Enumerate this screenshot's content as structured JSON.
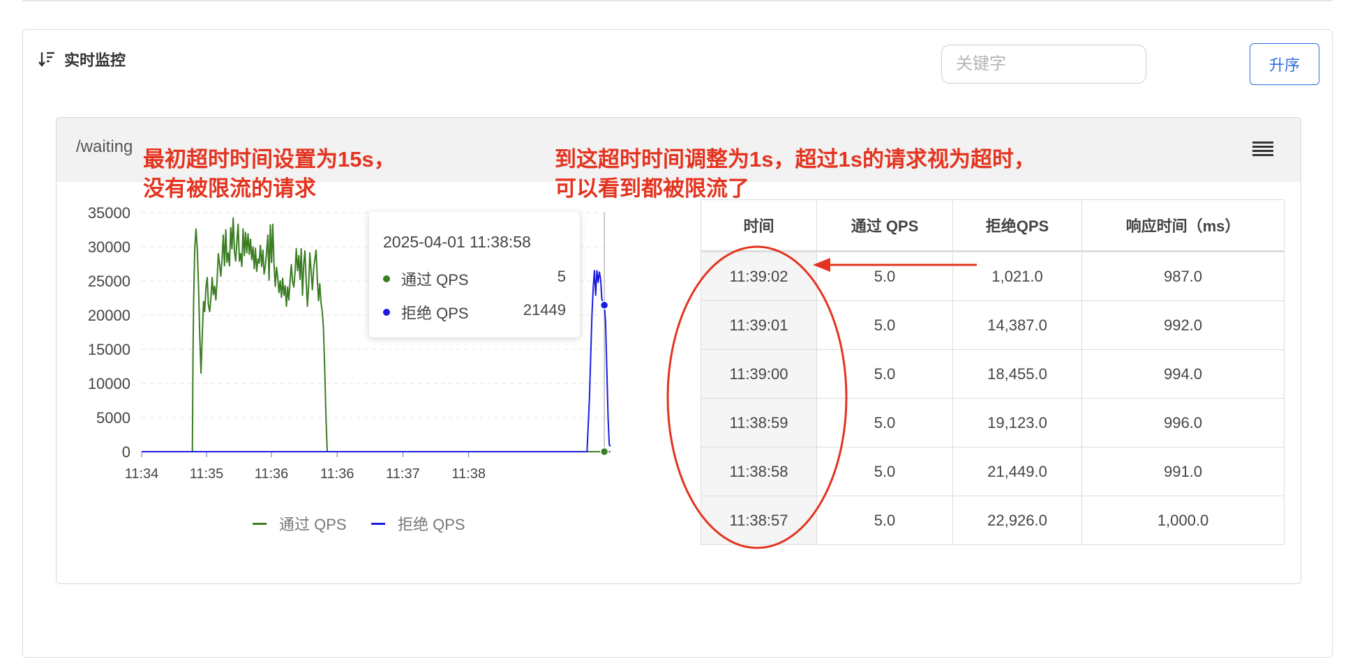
{
  "panel": {
    "title": "实时监控",
    "search_placeholder": "关键字",
    "sort_button": "升序"
  },
  "card": {
    "title": "/waiting"
  },
  "annotations": {
    "left_line1": "最初超时时间设置为15s，",
    "left_line2": "没有被限流的请求",
    "right_line1": "到这超时时间调整为1s，超过1s的请求视为超时，",
    "right_line2": "可以看到都被限流了"
  },
  "tooltip": {
    "time": "2025-04-01 11:38:58",
    "rows": [
      {
        "name": "通过 QPS",
        "value": "5",
        "color": "#3a7d22"
      },
      {
        "name": "拒绝 QPS",
        "value": "21449",
        "color": "#1a1ae0"
      }
    ]
  },
  "chart_data": {
    "type": "line",
    "y_ticks": [
      "35000",
      "30000",
      "25000",
      "20000",
      "15000",
      "10000",
      "5000",
      "0"
    ],
    "x_ticks": [
      "11:34",
      "11:35",
      "11:36",
      "11:36",
      "11:37",
      "11:38"
    ],
    "ylim": [
      0,
      35000
    ],
    "grid": true,
    "legend_position": "bottom",
    "series": [
      {
        "name": "通过 QPS",
        "color": "#3a7d22",
        "points": [
          [
            0,
            0
          ],
          [
            2,
            0
          ],
          [
            4,
            0
          ],
          [
            6,
            0
          ],
          [
            8,
            0
          ],
          [
            10,
            0
          ],
          [
            12,
            0
          ],
          [
            14,
            0
          ],
          [
            16,
            0
          ],
          [
            18,
            0
          ],
          [
            20,
            0
          ],
          [
            22,
            0
          ],
          [
            24,
            0
          ],
          [
            26,
            0
          ],
          [
            28,
            0
          ],
          [
            30,
            0
          ],
          [
            32,
            0
          ],
          [
            34,
            0
          ],
          [
            36,
            0
          ],
          [
            38,
            0
          ],
          [
            40,
            0
          ],
          [
            41,
            0
          ],
          [
            41.5,
            14000
          ],
          [
            42,
            22000
          ],
          [
            43,
            30000
          ],
          [
            44,
            32600
          ],
          [
            45,
            29500
          ],
          [
            46,
            24000
          ],
          [
            47,
            17000
          ],
          [
            48,
            11500
          ],
          [
            49,
            17000
          ],
          [
            50,
            22000
          ],
          [
            51,
            20500
          ],
          [
            52,
            24000
          ],
          [
            53,
            25500
          ],
          [
            54,
            21500
          ],
          [
            55,
            20500
          ],
          [
            56,
            22500
          ],
          [
            57,
            25500
          ],
          [
            58,
            23000
          ],
          [
            59,
            24200
          ],
          [
            60,
            22200
          ],
          [
            61,
            25200
          ],
          [
            62,
            29000
          ],
          [
            63,
            27400
          ],
          [
            64,
            25700
          ],
          [
            65,
            28300
          ],
          [
            66,
            31700
          ],
          [
            67,
            27200
          ],
          [
            68,
            32500
          ],
          [
            69,
            27700
          ],
          [
            70,
            29100
          ],
          [
            71,
            27200
          ],
          [
            72,
            32800
          ],
          [
            73,
            29700
          ],
          [
            74,
            34200
          ],
          [
            75,
            29300
          ],
          [
            76,
            27900
          ],
          [
            77,
            30700
          ],
          [
            78,
            33300
          ],
          [
            79,
            27900
          ],
          [
            80,
            29000
          ],
          [
            81,
            27100
          ],
          [
            82,
            32600
          ],
          [
            83,
            28700
          ],
          [
            84,
            32100
          ],
          [
            85,
            29100
          ],
          [
            86,
            31900
          ],
          [
            87,
            28900
          ],
          [
            88,
            31100
          ],
          [
            89,
            28100
          ],
          [
            90,
            30000
          ],
          [
            91,
            26800
          ],
          [
            92,
            29800
          ],
          [
            93,
            26400
          ],
          [
            94,
            28200
          ],
          [
            95,
            27600
          ],
          [
            96,
            30200
          ],
          [
            97,
            27100
          ],
          [
            98,
            29500
          ],
          [
            99,
            26000
          ],
          [
            100,
            27200
          ],
          [
            101,
            29200
          ],
          [
            102,
            31700
          ],
          [
            103,
            25100
          ],
          [
            104,
            33200
          ],
          [
            105,
            27700
          ],
          [
            106,
            33300
          ],
          [
            107,
            27500
          ],
          [
            108,
            24200
          ],
          [
            109,
            27000
          ],
          [
            110,
            25600
          ],
          [
            111,
            23300
          ],
          [
            112,
            25000
          ],
          [
            113,
            22600
          ],
          [
            114,
            25400
          ],
          [
            115,
            22900
          ],
          [
            116,
            24300
          ],
          [
            117,
            21300
          ],
          [
            118,
            24100
          ],
          [
            119,
            22200
          ],
          [
            120,
            25100
          ],
          [
            121,
            27400
          ],
          [
            122,
            24900
          ],
          [
            123,
            24100
          ],
          [
            124,
            26300
          ],
          [
            125,
            29700
          ],
          [
            126,
            26500
          ],
          [
            127,
            28700
          ],
          [
            128,
            25200
          ],
          [
            129,
            29700
          ],
          [
            130,
            22900
          ],
          [
            131,
            27400
          ],
          [
            132,
            29400
          ],
          [
            133,
            25000
          ],
          [
            134,
            21300
          ],
          [
            135,
            24400
          ],
          [
            136,
            29100
          ],
          [
            137,
            26400
          ],
          [
            138,
            23700
          ],
          [
            139,
            26800
          ],
          [
            140,
            28100
          ],
          [
            141,
            29500
          ],
          [
            142,
            25200
          ],
          [
            143,
            22100
          ],
          [
            144,
            24600
          ],
          [
            145,
            21800
          ],
          [
            146,
            20500
          ],
          [
            147,
            18000
          ],
          [
            148,
            12000
          ],
          [
            149,
            5000
          ],
          [
            150,
            0
          ],
          [
            152,
            0
          ],
          [
            160,
            0
          ],
          [
            170,
            0
          ],
          [
            180,
            0
          ],
          [
            190,
            0
          ],
          [
            200,
            0
          ],
          [
            210,
            0
          ],
          [
            220,
            0
          ],
          [
            230,
            0
          ],
          [
            240,
            0
          ],
          [
            250,
            0
          ],
          [
            260,
            0
          ],
          [
            270,
            0
          ],
          [
            280,
            0
          ],
          [
            290,
            0
          ],
          [
            300,
            0
          ],
          [
            310,
            0
          ],
          [
            320,
            0
          ],
          [
            330,
            0
          ],
          [
            340,
            0
          ],
          [
            350,
            0
          ],
          [
            358,
            0
          ],
          [
            362,
            0
          ],
          [
            366,
            0
          ],
          [
            370,
            0
          ],
          [
            374,
            5
          ],
          [
            376,
            5
          ],
          [
            378,
            0
          ],
          [
            379,
            0
          ]
        ]
      },
      {
        "name": "拒绝 QPS",
        "color": "#1a1ae0",
        "points": [
          [
            0,
            0
          ],
          [
            50,
            0
          ],
          [
            100,
            0
          ],
          [
            150,
            0
          ],
          [
            200,
            0
          ],
          [
            250,
            0
          ],
          [
            300,
            0
          ],
          [
            350,
            0
          ],
          [
            358,
            0
          ],
          [
            360,
            0
          ],
          [
            362,
            8000
          ],
          [
            363,
            14000
          ],
          [
            364,
            20000
          ],
          [
            365,
            24000
          ],
          [
            366,
            26500
          ],
          [
            367,
            22900
          ],
          [
            368,
            26500
          ],
          [
            369,
            24800
          ],
          [
            370,
            26300
          ],
          [
            371,
            25300
          ],
          [
            372,
            22300
          ],
          [
            373,
            21900
          ],
          [
            374,
            21449
          ],
          [
            375,
            19000
          ],
          [
            376,
            12000
          ],
          [
            377,
            5000
          ],
          [
            378,
            1000
          ],
          [
            379,
            800
          ]
        ]
      }
    ]
  },
  "table": {
    "headers": [
      "时间",
      "通过 QPS",
      "拒绝QPS",
      "响应时间（ms）"
    ],
    "rows": [
      [
        "11:39:02",
        "5.0",
        "1,021.0",
        "987.0"
      ],
      [
        "11:39:01",
        "5.0",
        "14,387.0",
        "992.0"
      ],
      [
        "11:39:00",
        "5.0",
        "18,455.0",
        "994.0"
      ],
      [
        "11:38:59",
        "5.0",
        "19,123.0",
        "996.0"
      ],
      [
        "11:38:58",
        "5.0",
        "21,449.0",
        "991.0"
      ],
      [
        "11:38:57",
        "5.0",
        "22,926.0",
        "1,000.0"
      ]
    ]
  },
  "colors": {
    "accent": "#2c6de0",
    "annotation": "#e4331f",
    "pass_series": "#3a7d22",
    "reject_series": "#1a1ae0"
  }
}
